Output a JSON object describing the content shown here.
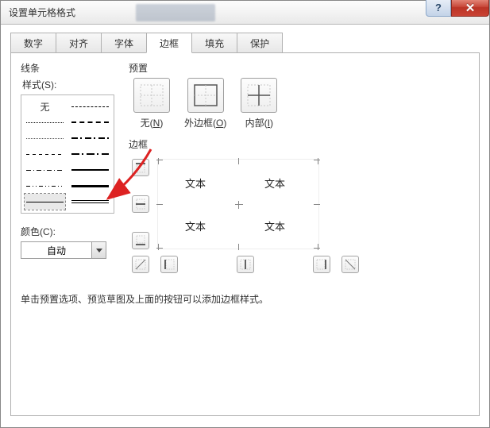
{
  "window": {
    "title": "设置单元格格式"
  },
  "tabs": [
    "数字",
    "对齐",
    "字体",
    "边框",
    "填充",
    "保护"
  ],
  "active_tab_index": 3,
  "sections": {
    "lines": "线条",
    "style": "样式(S):",
    "none_style": "无",
    "color": "颜色(C):",
    "color_value": "自动",
    "presets": "预置",
    "borders": "边框"
  },
  "preset_items": [
    {
      "label_pre": "无(",
      "hotkey": "N",
      "label_post": ")"
    },
    {
      "label_pre": "外边框(",
      "hotkey": "O",
      "label_post": ")"
    },
    {
      "label_pre": "内部(",
      "hotkey": "I",
      "label_post": ")"
    }
  ],
  "preview_cells": [
    "文本",
    "文本",
    "文本",
    "文本"
  ],
  "hint": "单击预置选项、预览草图及上面的按钮可以添加边框样式。"
}
